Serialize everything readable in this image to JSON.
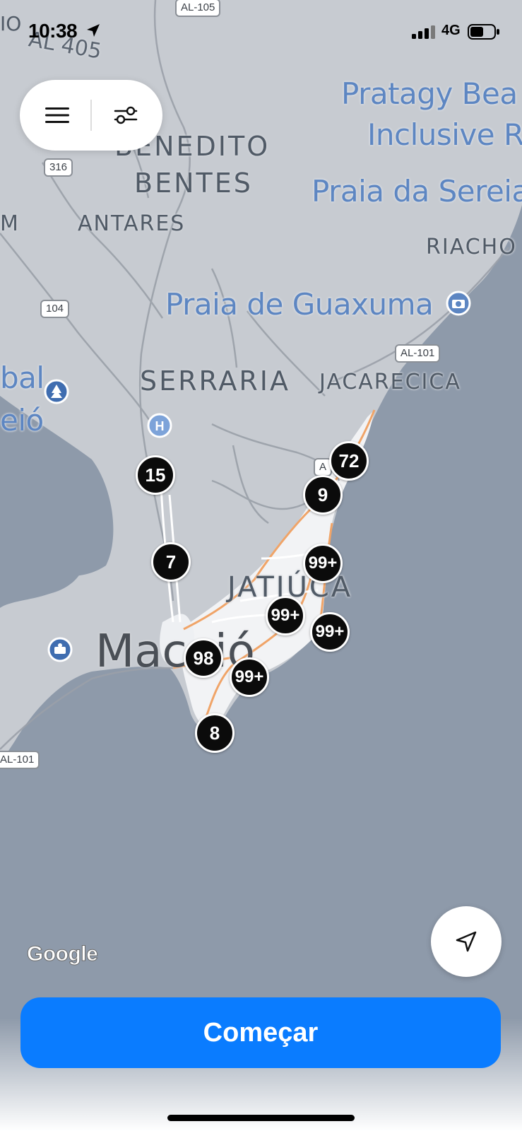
{
  "status_bar": {
    "time": "10:38",
    "network": "4G"
  },
  "toolbar": {
    "menu_icon": "hamburger-menu-icon",
    "filter_icon": "filter-sliders-icon"
  },
  "map": {
    "districts": [
      "BENEDITO",
      "BENTES",
      "ANTARES",
      "SERRARIA",
      "JACARECICA",
      "JATIÚCA",
      "RIACHO",
      "M"
    ],
    "places": [
      "Pratagy Bea",
      "Inclusive R",
      "Praia da Sereia",
      "Praia de Guaxuma",
      "bal",
      "eió"
    ],
    "city": "Maceió",
    "road_labels": [
      "AL-105",
      "AL 405",
      "316",
      "104",
      "AL-101",
      "AL-101",
      "A"
    ],
    "top_left_fragment": "IO",
    "clusters": [
      "72",
      "9",
      "15",
      "7",
      "99+",
      "99+",
      "99+",
      "98",
      "99+",
      "8"
    ]
  },
  "attribution": {
    "google": "Google"
  },
  "recenter": {
    "icon": "navigation-arrow-icon"
  },
  "cta": {
    "label": "Começar",
    "color": "#0a7cff"
  }
}
